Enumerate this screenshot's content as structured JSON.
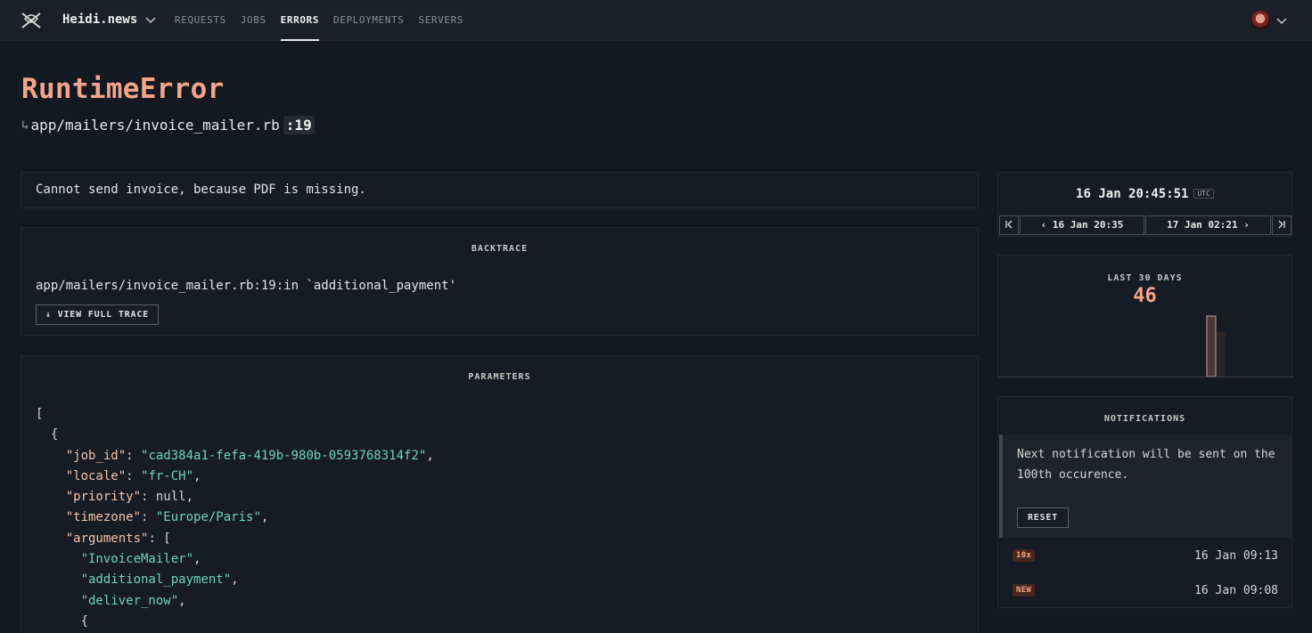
{
  "app": {
    "brand": "Heidi.news",
    "nav": [
      "REQUESTS",
      "JOBS",
      "ERRORS",
      "DEPLOYMENTS",
      "SERVERS"
    ],
    "active_nav": "ERRORS"
  },
  "error": {
    "title": "RuntimeError",
    "path_arrow": "↳",
    "file": "app/mailers/invoice_mailer.rb",
    "line": ":19",
    "message": "Cannot send invoice, because PDF is missing."
  },
  "backtrace": {
    "title": "BACKTRACE",
    "line": "app/mailers/invoice_mailer.rb:19:in `additional_payment'",
    "button": "↓ VIEW FULL TRACE"
  },
  "parameters": {
    "title": "PARAMETERS",
    "job_id": "\"cad384a1-fefa-419b-980b-0593768314f2\"",
    "locale": "\"fr-CH\"",
    "priority": "null",
    "timezone": "\"Europe/Paris\"",
    "arguments": [
      "\"InvoiceMailer\"",
      "\"additional_payment\"",
      "\"deliver_now\""
    ]
  },
  "occurrence": {
    "timestamp": "16 Jan 20:45:51",
    "tz": "UTC",
    "first": "K",
    "prev": "‹ 16 Jan 20:35",
    "next": "17 Jan 02:21 ›",
    "last": "K"
  },
  "stats": {
    "label": "LAST 30 DAYS",
    "count": "46"
  },
  "notifications": {
    "title": "NOTIFICATIONS",
    "text": "Next notification will be sent on the 100th occurence.",
    "reset": "RESET",
    "history": [
      {
        "badge": "10x",
        "time": "16 Jan 09:13"
      },
      {
        "badge": "NEW",
        "time": "16 Jan 09:08"
      }
    ]
  },
  "colors": {
    "accent": "#f2a58a",
    "string": "#6fd2c1",
    "key": "#f3c3ad",
    "background": "#141820"
  }
}
